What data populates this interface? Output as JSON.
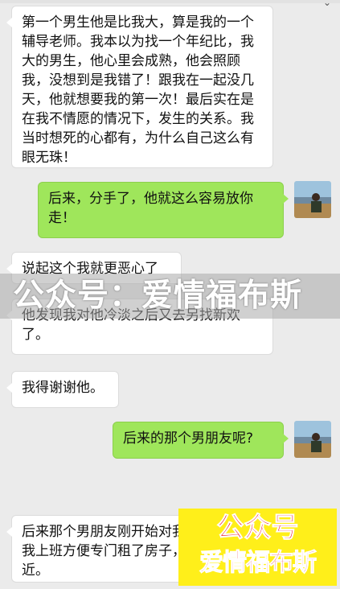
{
  "messages": [
    {
      "side": "left",
      "text": "第一个男生他是比我大，算是我的一个辅导老师。我本以为找一个年纪比，我大的男生，他心里会成熟，他会照顾我，没想到是我错了！跟我在一起没几天，他就想要我的第一次！最后实在是在我不情愿的情况下，发生的关系。我当时想死的心都有，为什么自己这么有眼无珠！"
    },
    {
      "side": "right",
      "text": "后来，分手了，他就这么容易放你走！"
    },
    {
      "side": "left",
      "text": "说起这个我就更恶心了"
    },
    {
      "side": "left",
      "text": "他发现我对他冷淡之后又去另找新欢了。"
    },
    {
      "side": "left",
      "text": "我得谢谢他。"
    },
    {
      "side": "right",
      "text": "后来的那个男朋友呢?"
    },
    {
      "side": "left",
      "text": "后来那个男朋友刚开始对我很好，为了我上班方便专门租了房子，在我公司附近。"
    }
  ],
  "watermark": "公众号：爱情福布斯",
  "promo": {
    "line1": "公众号",
    "line2": "爱情福布斯"
  },
  "colors": {
    "background": "#ebebeb",
    "incoming_bubble": "#ffffff",
    "outgoing_bubble": "#9fe65b",
    "promo_bg": "#ffef1a",
    "promo_text": "#e8141e"
  }
}
